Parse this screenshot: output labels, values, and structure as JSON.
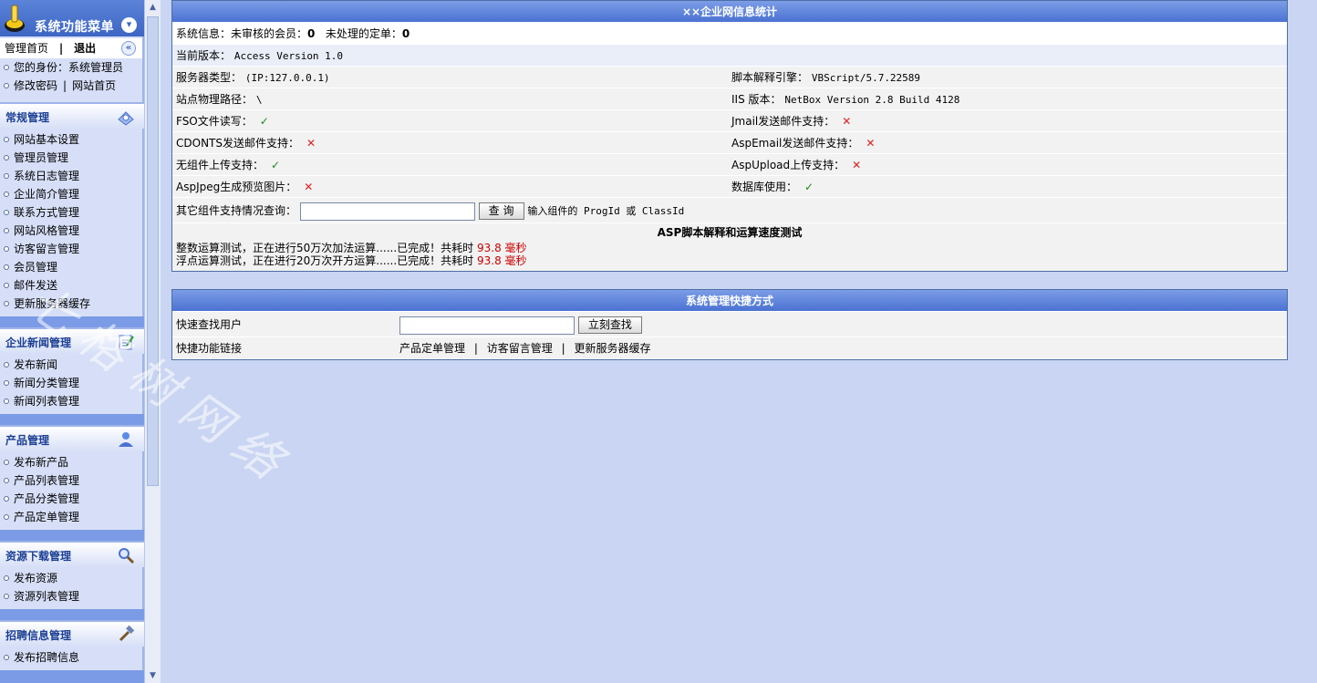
{
  "sidebar": {
    "title": "系统功能菜单",
    "top_links": {
      "home": "管理首页",
      "sep": "|",
      "exit": "退出"
    },
    "identity": "您的身份：系统管理员",
    "change_password": "修改密码",
    "site_home": "网站首页",
    "pipe": "|",
    "sections": [
      {
        "title": "常规管理",
        "icon": "gear-icon",
        "items": [
          "网站基本设置",
          "管理员管理",
          "系统日志管理",
          "企业简介管理",
          "联系方式管理",
          "网站风格管理",
          "访客留言管理",
          "会员管理",
          "邮件发送",
          "更新服务器缓存"
        ]
      },
      {
        "title": "企业新闻管理",
        "icon": "notepad-icon",
        "items": [
          "发布新闻",
          "新闻分类管理",
          "新闻列表管理"
        ]
      },
      {
        "title": "产品管理",
        "icon": "user-icon",
        "items": [
          "发布新产品",
          "产品列表管理",
          "产品分类管理",
          "产品定单管理"
        ]
      },
      {
        "title": "资源下载管理",
        "icon": "magnifier-icon",
        "items": [
          "发布资源",
          "资源列表管理"
        ]
      },
      {
        "title": "招聘信息管理",
        "icon": "hammer-icon",
        "items": [
          "发布招聘信息"
        ]
      }
    ]
  },
  "stats": {
    "title": "××企业网信息统计",
    "sysinfo_label": "系统信息：未审核的会员：",
    "pending_members": "0",
    "orders_label": "未处理的定单：",
    "pending_orders": "0",
    "version_label": "当前版本：",
    "version": "Access Version 1.0",
    "server_type_label": "服务器类型：",
    "server_type": "(IP:127.0.0.1)",
    "script_engine_label": "脚本解释引擎：",
    "script_engine": "VBScript/5.7.22589",
    "path_label": "站点物理路径：",
    "path": "\\",
    "iis_label": "IIS 版本：",
    "iis": "NetBox Version 2.8 Build 4128",
    "fso_label": "FSO文件读写：",
    "jmail_label": "Jmail发送邮件支持：",
    "cdonts_label": "CDONTS发送邮件支持：",
    "aspemail_label": "AspEmail发送邮件支持：",
    "upload_label": "无组件上传支持：",
    "aspupload_label": "AspUpload上传支持：",
    "aspjpeg_label": "AspJpeg生成预览图片：",
    "db_label": "数据库使用：",
    "check_mark": "✓",
    "cross_mark": "✕",
    "component_query_label": "其它组件支持情况查询：",
    "query_button": "查 询",
    "query_hint": "输入组件的 ProgId 或 ClassId",
    "speed_title": "ASP脚本解释和运算速度测试",
    "int_test": "整数运算测试，正在进行50万次加法运算......已完成！共耗时",
    "int_time": "93.8 毫秒",
    "float_test": "浮点运算测试，正在进行20万次开方运算......已完成！共耗时",
    "float_time": "93.8 毫秒"
  },
  "shortcuts": {
    "title": "系统管理快捷方式",
    "quick_find_label": "快速查找用户",
    "find_button": "立刻查找",
    "quick_links_label": "快捷功能链接",
    "links": [
      "产品定单管理",
      "访客留言管理",
      "更新服务器缓存"
    ],
    "pipe": "|"
  },
  "watermark": "七 格 树 网 络"
}
